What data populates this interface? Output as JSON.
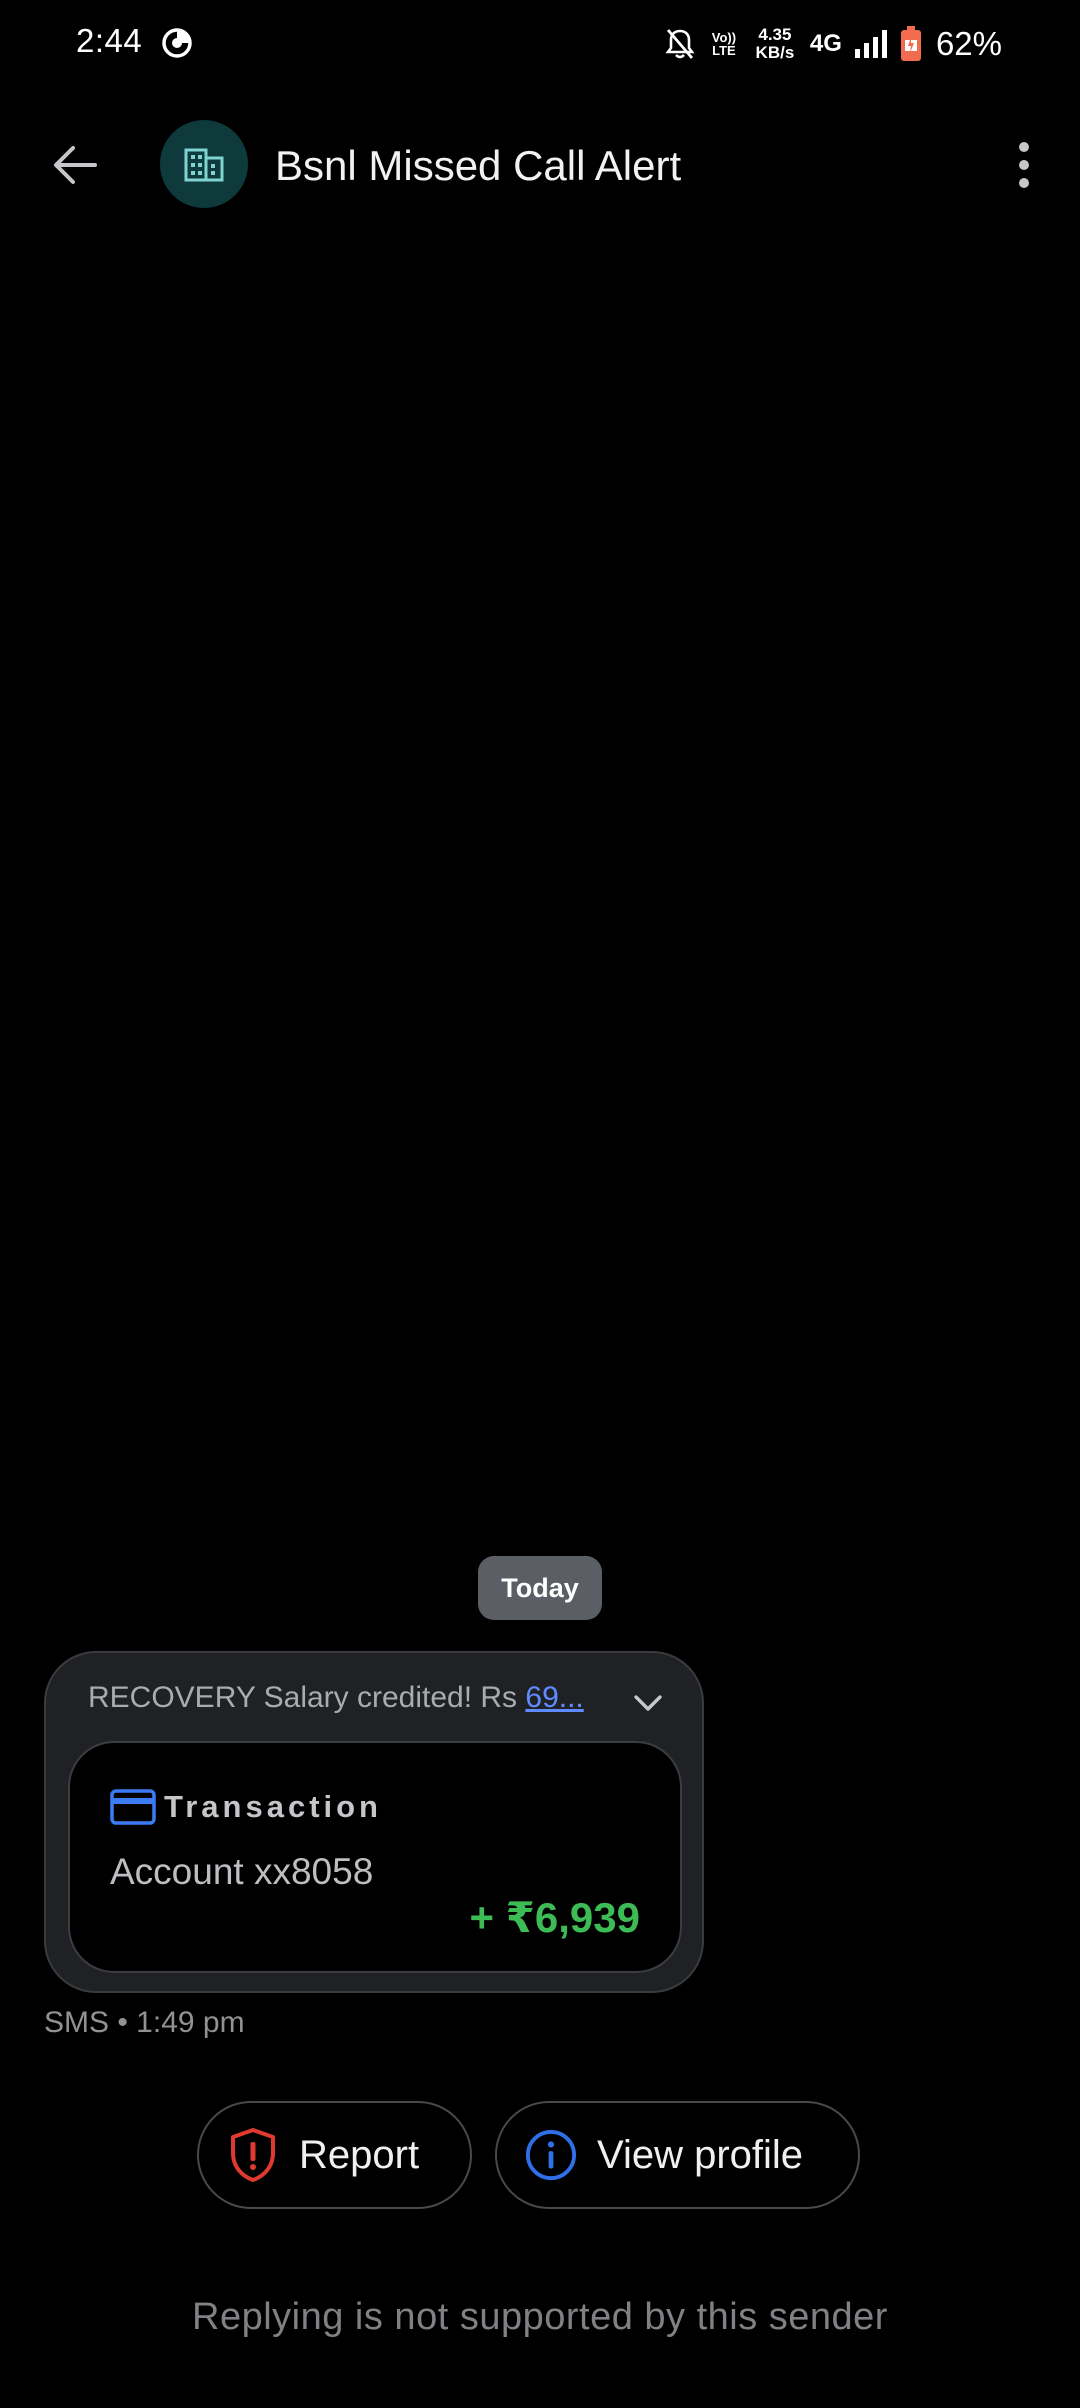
{
  "status_bar": {
    "time": "2:44",
    "volte_line1": "Vo))",
    "volte_line2": "LTE",
    "speed_value": "4.35",
    "speed_unit": "KB/s",
    "network": "4G",
    "battery_percent": "62%",
    "icons": [
      "data-saver-icon",
      "mute-bell-icon",
      "signal-icon",
      "battery-icon"
    ]
  },
  "app_bar": {
    "title": "Bsnl Missed Call Alert",
    "avatar_icon": "business-building-icon",
    "avatar_color": "#0e3a3c"
  },
  "conversation": {
    "date_chip": "Today",
    "message": {
      "preview_text": "RECOVERY Salary credited! Rs ",
      "preview_link": "69...",
      "card": {
        "label": "Transaction",
        "account": "Account xx8058",
        "amount": "+ ₹6,939",
        "amount_color": "#3dbb55"
      },
      "meta": "SMS • 1:49 pm"
    }
  },
  "actions": {
    "report_label": "Report",
    "report_color": "#e03a30",
    "view_profile_label": "View profile",
    "view_profile_color": "#2f6fe8"
  },
  "footer": {
    "note": "Replying is not supported by this sender"
  }
}
